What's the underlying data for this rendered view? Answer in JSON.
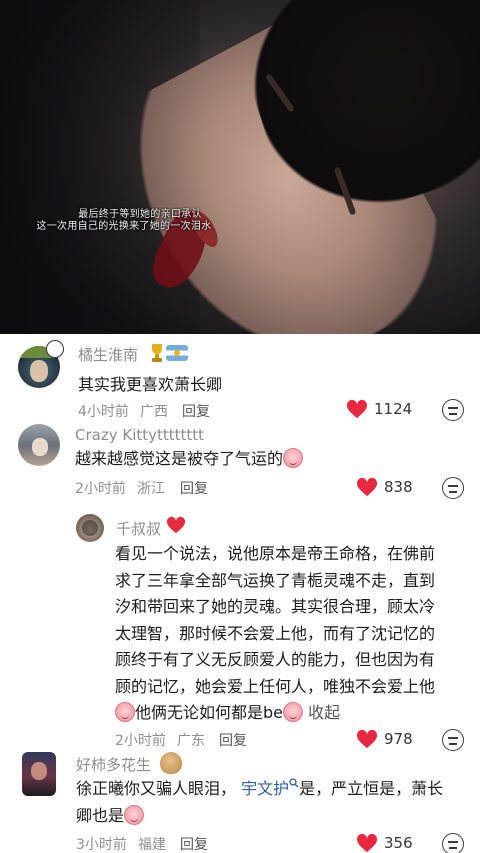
{
  "video": {
    "subtitle_line1": "最后终于等到她的亲口承认",
    "subtitle_line2": "这一次用自己的光换来了她的一次泪水"
  },
  "colors": {
    "heart": "#e8283f",
    "link": "#2d5fa6",
    "muted": "#8c8c8c"
  },
  "comments": [
    {
      "name": "橘生淮南",
      "text": "其实我更喜欢萧长卿",
      "time": "4小时前",
      "location": "广西",
      "reply": "回复",
      "likes": "1124",
      "badges": [
        "trophy-icon",
        "argentina-flag-icon"
      ]
    },
    {
      "name": "Crazy Kittytttttttt",
      "text": "越来越感觉这是被夺了气运的",
      "time": "2小时前",
      "location": "浙江",
      "reply": "回复",
      "likes": "838"
    },
    {
      "name": "千叔叔",
      "text_lines": [
        "看见一个说法，说他原本是帝王命格，在佛前",
        "求了三年拿全部气运换了青栀灵魂不走，直到",
        "汐和带回来了她的灵魂。其实很合理，顾太冷",
        "太理智，那时候不会爱上他，而有了沈记忆的",
        "顾终于有了义无反顾爱人的能力，但也因为有",
        "顾的记忆，她会爱上任何人，唯独不会爱上他"
      ],
      "last_line_a": "他俩无论如何都是be",
      "collapse": "收起",
      "time": "2小时前",
      "location": "广东",
      "reply": "回复",
      "likes": "978"
    },
    {
      "name": "好柿多花生",
      "text_a": "徐正曦你又骗人眼泪，",
      "link": "宇文护",
      "link_icon": "search-icon",
      "text_b": "是，严立恒是，萧长",
      "text_line2": "卿也是",
      "time": "3小时前",
      "location": "福建",
      "reply": "回复",
      "likes": "356"
    }
  ]
}
